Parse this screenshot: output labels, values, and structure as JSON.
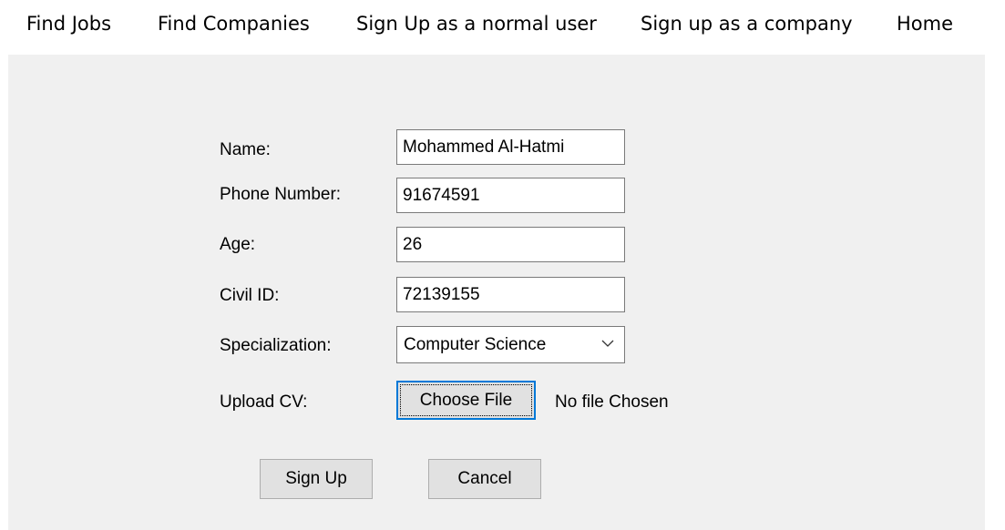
{
  "menu": {
    "find_jobs": "Find Jobs",
    "find_companies": "Find Companies",
    "signup_user": "Sign Up as a normal user",
    "signup_company": "Sign up as a company",
    "home": "Home"
  },
  "form": {
    "name_label": "Name:",
    "name_value": "Mohammed Al-Hatmi",
    "phone_label": "Phone Number:",
    "phone_value": "91674591",
    "age_label": "Age:",
    "age_value": "26",
    "civil_id_label": "Civil ID:",
    "civil_id_value": "72139155",
    "specialization_label": "Specialization:",
    "specialization_value": "Computer Science",
    "upload_cv_label": "Upload CV:",
    "choose_file_label": "Choose File",
    "file_status": "No file Chosen"
  },
  "actions": {
    "sign_up_label": "Sign Up",
    "cancel_label": "Cancel"
  },
  "icons": {
    "dropdown": "chevron-down-icon"
  },
  "colors": {
    "client_background": "#f0f0f0",
    "button_background": "#e1e1e1",
    "focus_border": "#0078d7"
  }
}
